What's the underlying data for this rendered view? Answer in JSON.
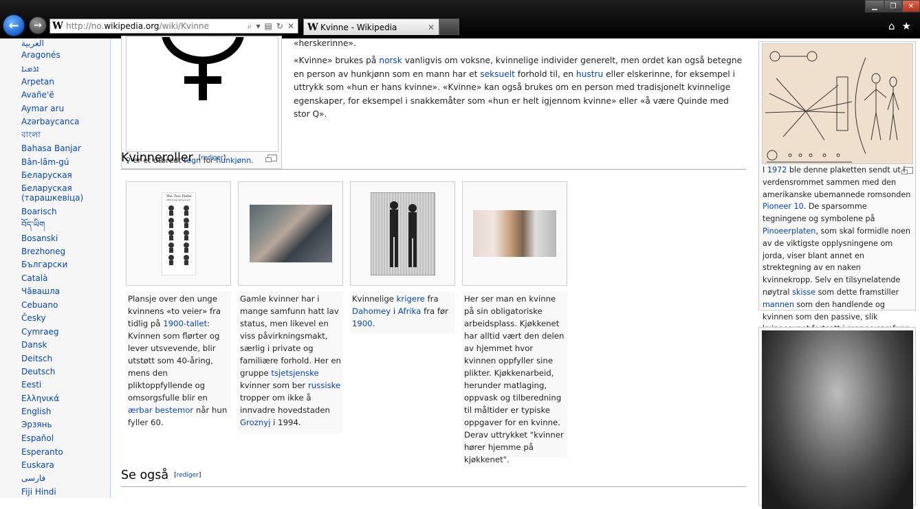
{
  "browser": {
    "url_prefix": "http://no.",
    "url_domain": "wikipedia.org",
    "url_path": "/wiki/Kvinne",
    "tab_title": "Kvinne - Wikipedia",
    "favicon": "W",
    "back_glyph": "←",
    "forward_glyph": "→",
    "search_glyph": "⌕",
    "dropdown_glyph": "▾",
    "compat_glyph": "▤",
    "refresh_glyph": "↻",
    "stop_glyph": "✕",
    "tab_close_glyph": "✕",
    "home_glyph": "⌂",
    "fav_glyph": "★",
    "min_glyph": "▁",
    "max_glyph": "❐",
    "close_glyph": "✕"
  },
  "sidebar": {
    "languages": [
      "العربية",
      "Aragonés",
      "ܐܪܡܝܐ",
      "Arpetan",
      "Avañe'ẽ",
      "Aymar aru",
      "Azərbaycanca",
      "বাংলা",
      "Bahasa Banjar",
      "Bân-lâm-gú",
      "Беларуская",
      "Беларуская",
      "(тарашкевіца)",
      "Boarisch",
      "བོད་ཡིག",
      "Bosanski",
      "Brezhoneg",
      "Български",
      "Català",
      "Чӑвашла",
      "Cebuano",
      "Česky",
      "Cymraeg",
      "Dansk",
      "Deitsch",
      "Deutsch",
      "Eesti",
      "Ελληνικά",
      "English",
      "Эрзянь",
      "Español",
      "Esperanto",
      "Euskara",
      "فارسی",
      "Fiji Hindi"
    ]
  },
  "top": {
    "herskerinne": "«herskerinne».",
    "p1": [
      "«Kvinne» brukes på ",
      "norsk",
      " vanligvis om voksne, kvinnelige individer generelt, men ordet kan også betegne en person av hunkjønn som en mann har et ",
      "seksuelt",
      " forhold til, en ",
      "hustru",
      " eller elskerinne, for eksempel i uttrykk som «hun er hans kvinne». «Kvinne» kan også brukes om en person med tradisjonelt kvinnelige egenskaper, for eksempel i snakkemåter som «hun er helt igjennom kvinne» eller «å være Quinde med stor Q»."
    ],
    "symbol_caption": [
      "♀",
      " er et utbredt ",
      "tegn",
      " for ",
      "hunkjønn",
      "."
    ]
  },
  "sections": {
    "kvinneroller": "Kvinneroller",
    "se_ogsa": "Se også",
    "edit": "rediger"
  },
  "gallery": [
    {
      "caption": [
        "Plansje over den unge kvinnens «to veier» fra tidlig på ",
        "1900-tallet",
        ": Kvinnen som flørter og lever utsvevende, blir utstøtt som 40-åring, mens den pliktoppfyllende og omsorgsfulle blir en ",
        "ærbar bestemor",
        " når hun fyller 60."
      ]
    },
    {
      "caption": [
        "Gamle kvinner har i mange samfunn hatt lav status, men likevel en viss påvirkningsmakt, særlig i private og familiære forhold. Her en gruppe ",
        "tsjetsjenske",
        " kvinner som ber ",
        "russiske",
        " tropper om ikke å innvadre hovedstaden ",
        "Groznyj",
        " i 1994."
      ]
    },
    {
      "caption": [
        "Kvinnelige ",
        "krigere",
        " fra ",
        "Dahomey",
        " i ",
        "Afrika",
        " fra før ",
        "1900",
        "."
      ]
    },
    {
      "caption": [
        "Her ser man en kvinne på sin obligatoriske arbeidsplass. Kjøkkenet har alltid vært den delen av hjemmet hvor kvinnen oppfyller sine plikter. Kjøkkenarbeid, herunder matlaging, oppvask og tilberedning til måltider er typiske oppgaver for en kvinne. Derav uttrykket \"kvinner hører hjemme på kjøkkenet\"."
      ]
    }
  ],
  "plate": {
    "caption": [
      "I ",
      "1972",
      " ble denne plaketten sendt ut i verdensrommet sammen med den amerikanske ubemannede romsonden ",
      "Pioneer 10",
      ". De sparsomme tegningene og symbolene på ",
      "Pinoeerplaten",
      ", som skal formidle noen av de viktigste opplysningene om jorda, viser blant annet en strektegning av en naken kvinnekropp. Selv en tilsynelatende nøytral ",
      "skisse",
      " som dette framstiller ",
      "mannen",
      " som den handlende og kvinnen som den passive, slik kvinnesynet fortsatt i mange samfunn er."
    ]
  },
  "poster": {
    "title": "The Two Paths",
    "subtitle": "Which way will you go?"
  },
  "icons": {
    "venus": "venus-symbol-icon",
    "enlarge": "magnify-clip-icon"
  },
  "colors": {
    "link": "#0645ad",
    "sidebar_bg": "#f6f6f6",
    "sidebar_border": "#a7d7f9"
  }
}
